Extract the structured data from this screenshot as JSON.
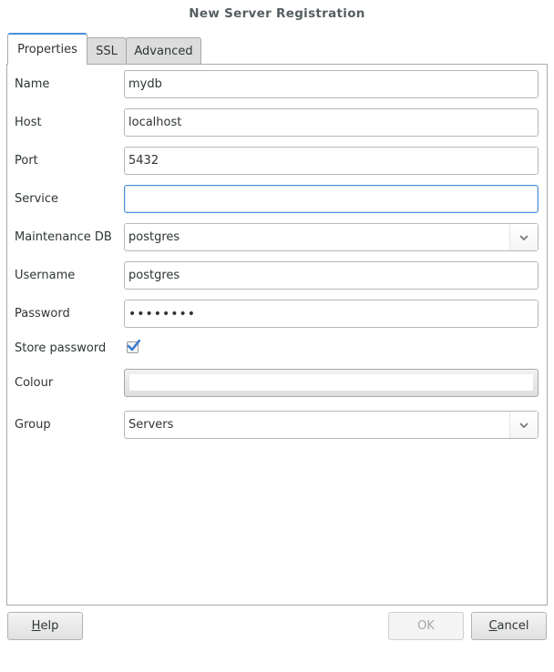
{
  "window": {
    "title": "New Server Registration"
  },
  "tabs": [
    {
      "label": "Properties",
      "active": true
    },
    {
      "label": "SSL",
      "active": false
    },
    {
      "label": "Advanced",
      "active": false
    }
  ],
  "form": {
    "name": {
      "label": "Name",
      "value": "mydb"
    },
    "host": {
      "label": "Host",
      "value": "localhost"
    },
    "port": {
      "label": "Port",
      "value": "5432"
    },
    "service": {
      "label": "Service",
      "value": ""
    },
    "maintenance_db": {
      "label": "Maintenance DB",
      "value": "postgres"
    },
    "username": {
      "label": "Username",
      "value": "postgres"
    },
    "password": {
      "label": "Password",
      "value": "••••••••"
    },
    "store_password": {
      "label": "Store password",
      "checked": true
    },
    "colour": {
      "label": "Colour",
      "value": "#ffffff"
    },
    "group": {
      "label": "Group",
      "value": "Servers"
    }
  },
  "buttons": {
    "help": {
      "mnemonic": "H",
      "rest": "elp"
    },
    "ok": {
      "label": "OK",
      "enabled": false
    },
    "cancel": {
      "mnemonic": "C",
      "rest": "ancel"
    }
  },
  "colors": {
    "accent": "#4a90d9",
    "check": "#3d7bd1"
  }
}
